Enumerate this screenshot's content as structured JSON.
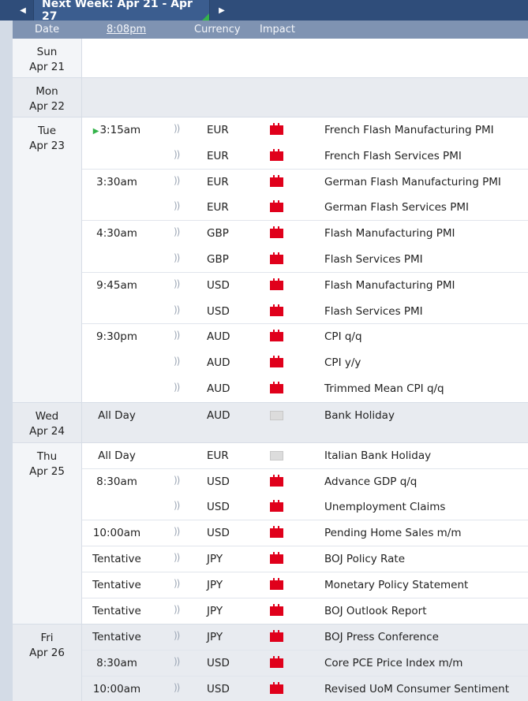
{
  "week_nav": {
    "label": "Next Week: Apr 21 - Apr 27"
  },
  "columns": {
    "date": "Date",
    "time": "8:08pm",
    "currency": "Currency",
    "impact": "Impact"
  },
  "days": [
    {
      "dow": "Sun",
      "date": "Apr 21",
      "events": []
    },
    {
      "dow": "Mon",
      "date": "Apr 22",
      "events": []
    },
    {
      "dow": "Tue",
      "date": "Apr 23",
      "events": [
        {
          "time": "3:15am",
          "currency": "EUR",
          "impact": "high",
          "name": "French Flash Manufacturing PMI",
          "upnext": true
        },
        {
          "time": "",
          "currency": "EUR",
          "impact": "high",
          "name": "French Flash Services PMI"
        },
        {
          "time": "3:30am",
          "currency": "EUR",
          "impact": "high",
          "name": "German Flash Manufacturing PMI"
        },
        {
          "time": "",
          "currency": "EUR",
          "impact": "high",
          "name": "German Flash Services PMI"
        },
        {
          "time": "4:30am",
          "currency": "GBP",
          "impact": "high",
          "name": "Flash Manufacturing PMI"
        },
        {
          "time": "",
          "currency": "GBP",
          "impact": "high",
          "name": "Flash Services PMI"
        },
        {
          "time": "9:45am",
          "currency": "USD",
          "impact": "high",
          "name": "Flash Manufacturing PMI"
        },
        {
          "time": "",
          "currency": "USD",
          "impact": "high",
          "name": "Flash Services PMI"
        },
        {
          "time": "9:30pm",
          "currency": "AUD",
          "impact": "high",
          "name": "CPI q/q"
        },
        {
          "time": "",
          "currency": "AUD",
          "impact": "high",
          "name": "CPI y/y"
        },
        {
          "time": "",
          "currency": "AUD",
          "impact": "high",
          "name": "Trimmed Mean CPI q/q"
        }
      ]
    },
    {
      "dow": "Wed",
      "date": "Apr 24",
      "events": [
        {
          "time": "All Day",
          "currency": "AUD",
          "impact": "none",
          "name": "Bank Holiday"
        }
      ]
    },
    {
      "dow": "Thu",
      "date": "Apr 25",
      "events": [
        {
          "time": "All Day",
          "currency": "EUR",
          "impact": "none",
          "name": "Italian Bank Holiday"
        },
        {
          "time": "8:30am",
          "currency": "USD",
          "impact": "high",
          "name": "Advance GDP q/q"
        },
        {
          "time": "",
          "currency": "USD",
          "impact": "high",
          "name": "Unemployment Claims"
        },
        {
          "time": "10:00am",
          "currency": "USD",
          "impact": "high",
          "name": "Pending Home Sales m/m"
        },
        {
          "time": "Tentative",
          "currency": "JPY",
          "impact": "high",
          "name": "BOJ Policy Rate"
        },
        {
          "time": "Tentative",
          "currency": "JPY",
          "impact": "high",
          "name": "Monetary Policy Statement"
        },
        {
          "time": "Tentative",
          "currency": "JPY",
          "impact": "high",
          "name": "BOJ Outlook Report"
        }
      ]
    },
    {
      "dow": "Fri",
      "date": "Apr 26",
      "events": [
        {
          "time": "Tentative",
          "currency": "JPY",
          "impact": "high",
          "name": "BOJ Press Conference"
        },
        {
          "time": "8:30am",
          "currency": "USD",
          "impact": "high",
          "name": "Core PCE Price Index m/m"
        },
        {
          "time": "10:00am",
          "currency": "USD",
          "impact": "high",
          "name": "Revised UoM Consumer Sentiment"
        }
      ]
    }
  ],
  "colors": {
    "header_bar": "#2f4d7a",
    "column_header": "#7f93b2",
    "impact_high": "#e0001b",
    "impact_none": "#dcdcdc",
    "upnext_arrow": "#34b34a"
  }
}
